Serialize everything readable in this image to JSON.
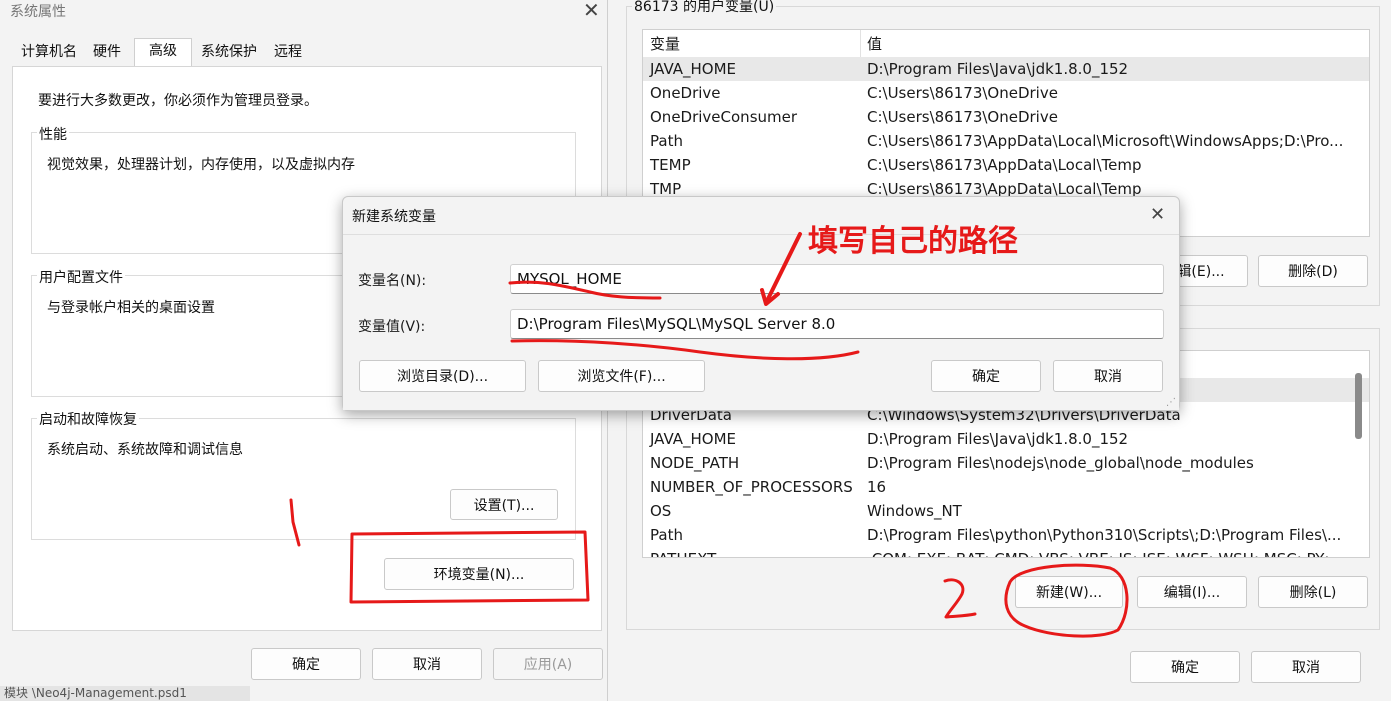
{
  "system_properties": {
    "title": "系统属性",
    "tabs": [
      {
        "label": "计算机名",
        "active": false
      },
      {
        "label": "硬件",
        "active": false
      },
      {
        "label": "高级",
        "active": true
      },
      {
        "label": "系统保护",
        "active": false
      },
      {
        "label": "远程",
        "active": false
      }
    ],
    "admin_note": "要进行大多数更改，你必须作为管理员登录。",
    "performance": {
      "legend": "性能",
      "description": "视觉效果，处理器计划，内存使用，以及虚拟内存"
    },
    "user_profiles": {
      "legend": "用户配置文件",
      "description": "与登录帐户相关的桌面设置"
    },
    "startup_recovery": {
      "legend": "启动和故障恢复",
      "description": "系统启动、系统故障和调试信息",
      "settings_button": "设置(T)..."
    },
    "env_vars_button": "环境变量(N)...",
    "ok_button": "确定",
    "cancel_button": "取消",
    "apply_button": "应用(A)",
    "taskbar_text": "模块  \\Neo4j-Management.psd1"
  },
  "env_window": {
    "user_vars_title": "86173 的用户变量(U)",
    "columns": {
      "name": "变量",
      "value": "值"
    },
    "user_vars": [
      {
        "name": "JAVA_HOME",
        "value": "D:\\Program Files\\Java\\jdk1.8.0_152"
      },
      {
        "name": "OneDrive",
        "value": "C:\\Users\\86173\\OneDrive"
      },
      {
        "name": "OneDriveConsumer",
        "value": "C:\\Users\\86173\\OneDrive"
      },
      {
        "name": "Path",
        "value": "C:\\Users\\86173\\AppData\\Local\\Microsoft\\WindowsApps;D:\\Pro..."
      },
      {
        "name": "TEMP",
        "value": "C:\\Users\\86173\\AppData\\Local\\Temp"
      },
      {
        "name": "TMP",
        "value": "C:\\Users\\86173\\AppData\\Local\\Temp"
      }
    ],
    "user_edit_button": "编辑(E)...",
    "user_delete_button": "删除(D)",
    "system_vars": [
      {
        "name": "DriverData",
        "value": "C:\\Windows\\System32\\Drivers\\DriverData"
      },
      {
        "name": "JAVA_HOME",
        "value": "D:\\Program Files\\Java\\jdk1.8.0_152"
      },
      {
        "name": "NODE_PATH",
        "value": "D:\\Program Files\\nodejs\\node_global\\node_modules"
      },
      {
        "name": "NUMBER_OF_PROCESSORS",
        "value": "16"
      },
      {
        "name": "OS",
        "value": "Windows_NT"
      },
      {
        "name": "Path",
        "value": "D:\\Program Files\\python\\Python310\\Scripts\\;D:\\Program Files\\..."
      },
      {
        "name": "PATHEXT",
        "value": ".COM;.EXE;.BAT;.CMD;.VBS;.VBE;.JS;.JSE;.WSF;.WSH;.MSC;.PY;.PYW"
      }
    ],
    "sys_new_button": "新建(W)...",
    "sys_edit_button": "编辑(I)...",
    "sys_delete_button": "删除(L)",
    "ok_button": "确定",
    "cancel_button": "取消"
  },
  "new_var_dialog": {
    "title": "新建系统变量",
    "name_label": "变量名(N):",
    "name_value": "MYSQL_HOME",
    "value_label": "变量值(V):",
    "value_value": "D:\\Program Files\\MySQL\\MySQL Server 8.0",
    "browse_dir_button": "浏览目录(D)...",
    "browse_file_button": "浏览文件(F)...",
    "ok_button": "确定",
    "cancel_button": "取消"
  },
  "annotations": {
    "hint_text": "填写自己的路径",
    "color": "#e61919"
  }
}
